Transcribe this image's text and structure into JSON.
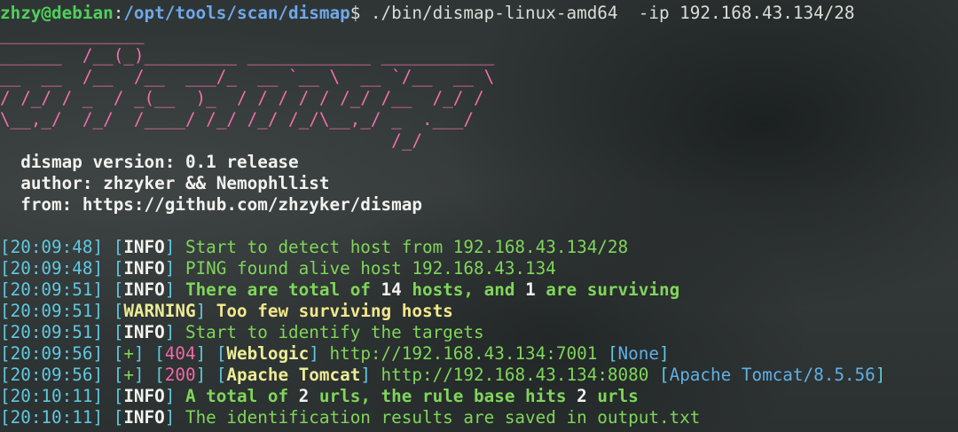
{
  "prompt": {
    "user": "zhzy@debian",
    "sep": ":",
    "path": "/opt/tools/scan/dismap",
    "dollar": "$",
    "command": " ./bin/dismap-linux-amd64  -ip 192.168.43.134/28"
  },
  "banner": {
    "art": "______________\n______  /__(_)_________ ____________ ___________\n__  __  /__  /__  ___/_  __ `__ \\  __ `/__  __ \\\n/ /_/ / _  / _(__  )_  / / / / / /_/ /__  /_/ /\n\\__,_/  /_/  /____/ /_/ /_/ /_/\\__,_/ _  .___/\n                                      /_/"
  },
  "info": {
    "version": "dismap version: 0.1 release",
    "author": "author: zhzyker && Nemophllist",
    "from": "from: https://github.com/zhzyker/dismap"
  },
  "log": [
    {
      "ts": "[20:09:48]",
      "tag": "INFO",
      "msg": "Start to detect host from 192.168.43.134/28"
    },
    {
      "ts": "[20:09:48]",
      "tag": "INFO",
      "msg": "PING found alive host 192.168.43.134"
    },
    {
      "ts": "[20:09:51]",
      "tag": "INFO",
      "p1": "There are total of",
      "n1": "14",
      "p2": "hosts, and",
      "n2": "1",
      "p3": "are surviving"
    },
    {
      "ts": "[20:09:51]",
      "tag": "WARNING",
      "msg": "Too few surviving hosts"
    },
    {
      "ts": "[20:09:51]",
      "tag": "INFO",
      "msg": "Start to identify the targets"
    },
    {
      "ts": "[20:09:56]",
      "tag": "+",
      "code": "404",
      "app": "Weblogic",
      "url": "http://192.168.43.134:7001",
      "ver": "None"
    },
    {
      "ts": "[20:09:56]",
      "tag": "+",
      "code": "200",
      "app": "Apache Tomcat",
      "url": "http://192.168.43.134:8080",
      "ver": "Apache Tomcat/8.5.56"
    },
    {
      "ts": "[20:10:11]",
      "tag": "INFO",
      "p1": "A total of",
      "n1": "2",
      "p2": "urls, the rule base hits",
      "n2": "2",
      "p3": "urls"
    },
    {
      "ts": "[20:10:11]",
      "tag": "INFO",
      "msg": "The identification results are saved in output.txt"
    }
  ],
  "colors": {
    "background": "#2d3232",
    "prompt_user": "#4fd05b",
    "prompt_path": "#6fa8e8",
    "banner": "#f06fa8",
    "timestamp": "#5fc9e0",
    "message": "#7fd65a",
    "warning": "#f2e88c"
  }
}
